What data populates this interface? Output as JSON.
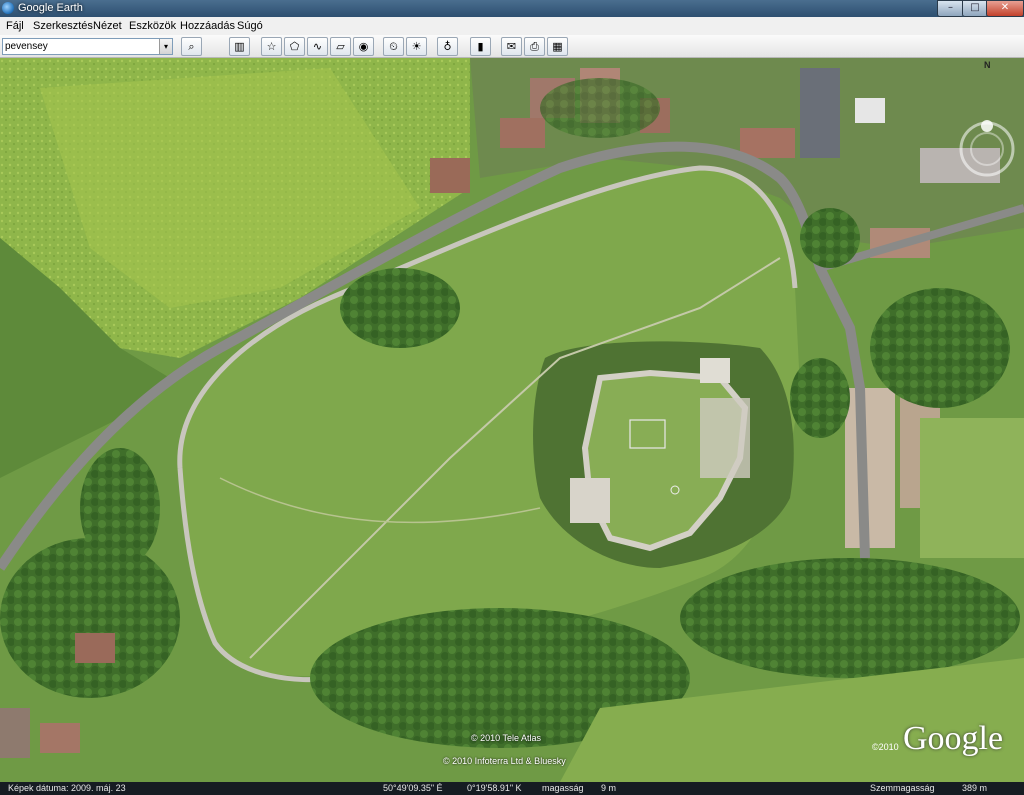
{
  "window": {
    "title": "Google Earth",
    "app_icon": "google-earth-icon",
    "controls": {
      "minimize": "–",
      "maximize": "□",
      "close": "✕"
    }
  },
  "menu": {
    "items": [
      "Fájl",
      "Szerkesztés",
      "Nézet",
      "Eszközök",
      "Hozzáadás",
      "Súgó"
    ]
  },
  "toolbar": {
    "search_value": "pevensey",
    "dropdown": "▾",
    "buttons": [
      {
        "icon": "search-icon",
        "glyph": "⌕"
      },
      {
        "icon": "sidebar-icon",
        "glyph": "▥"
      },
      {
        "icon": "placemark-icon",
        "glyph": "☆"
      },
      {
        "icon": "polygon-icon",
        "glyph": "⬠"
      },
      {
        "icon": "path-icon",
        "glyph": "∿"
      },
      {
        "icon": "image-overlay-icon",
        "glyph": "▱"
      },
      {
        "icon": "record-tour-icon",
        "glyph": "◉"
      },
      {
        "icon": "historical-imagery-icon",
        "glyph": "⏲"
      },
      {
        "icon": "sunlight-icon",
        "glyph": "☀"
      },
      {
        "icon": "planets-icon",
        "glyph": "♁"
      },
      {
        "icon": "ruler-icon",
        "glyph": "▮"
      },
      {
        "icon": "email-icon",
        "glyph": "✉"
      },
      {
        "icon": "print-icon",
        "glyph": "⎙"
      },
      {
        "icon": "google-maps-icon",
        "glyph": "▦"
      }
    ]
  },
  "map": {
    "compass_north": "N",
    "attributions": [
      "© 2010 Tele Atlas",
      "© 2010 Infoterra Ltd & Bluesky"
    ],
    "logo_year": "©2010",
    "logo": "Google",
    "colors": {
      "grass": "#6f9a45",
      "field": "#8fb64a",
      "road": "#8a8a88",
      "wall": "#c8c6bd",
      "trees": "#3f6e2a"
    }
  },
  "status": {
    "image_date": "Képek dátuma: 2009. máj. 23",
    "lat": "50°49'09.35\" É",
    "lon": "0°19'58.91\" K",
    "elevation_label": "magasság",
    "elevation_value": "9 m",
    "eye_alt_label": "Szemmagasság",
    "eye_alt_value": "389 m"
  }
}
